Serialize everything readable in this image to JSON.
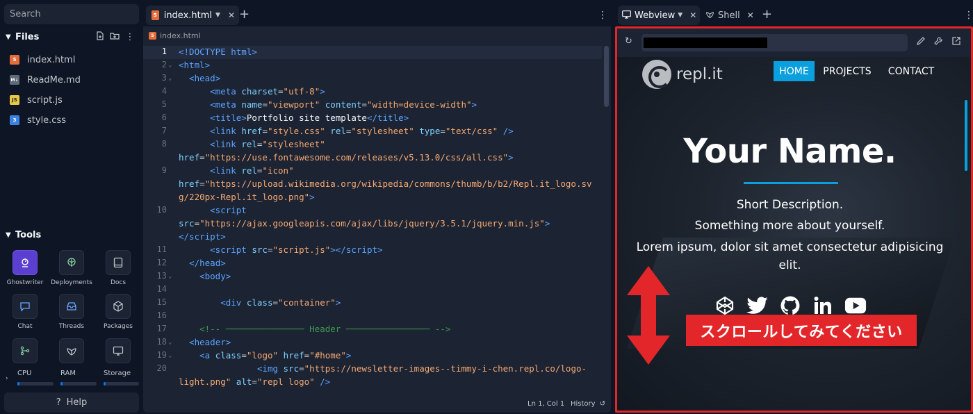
{
  "sidebar": {
    "search_placeholder": "Search",
    "files_title": "Files",
    "files": [
      {
        "name": "index.html",
        "type": "HTML"
      },
      {
        "name": "ReadMe.md",
        "type": "M↓"
      },
      {
        "name": "script.js",
        "type": "JS"
      },
      {
        "name": "style.css",
        "type": "CSS"
      }
    ],
    "tools_title": "Tools",
    "tools": [
      "Ghostwriter",
      "Deployments",
      "Docs",
      "Chat",
      "Threads",
      "Packages"
    ],
    "resources": [
      "CPU",
      "RAM",
      "Storage"
    ],
    "help_label": "Help"
  },
  "editor": {
    "tab_label": "index.html",
    "breadcrumb": "index.html",
    "status_position": "Ln 1, Col 1",
    "status_history": "History",
    "line_numbers": [
      "1",
      "2",
      "3",
      "4",
      "5",
      "6",
      "7",
      "8",
      "9",
      "10",
      "11",
      "12",
      "13",
      "14",
      "15",
      "16",
      "17",
      "18",
      "19",
      "20"
    ]
  },
  "webview": {
    "tab_webview": "Webview",
    "tab_shell": "Shell",
    "site": {
      "logo_text": "repl.it",
      "nav": [
        "HOME",
        "PROJECTS",
        "CONTACT"
      ],
      "title": "Your Name.",
      "desc1": "Short Description.",
      "desc2": "Something more about yourself.",
      "desc3a": "Lorem ipsum, dolor sit amet consectetur adipisicing",
      "desc3b": "elit.",
      "social_icons": [
        "codepen-icon",
        "twitter-icon",
        "github-icon",
        "linkedin-icon",
        "youtube-icon"
      ]
    },
    "annotation": "スクロールしてみてください"
  },
  "colors": {
    "accent": "#0aa0dd",
    "annotation_red": "#e3262a",
    "ghostwriter": "#5b3fd1"
  }
}
